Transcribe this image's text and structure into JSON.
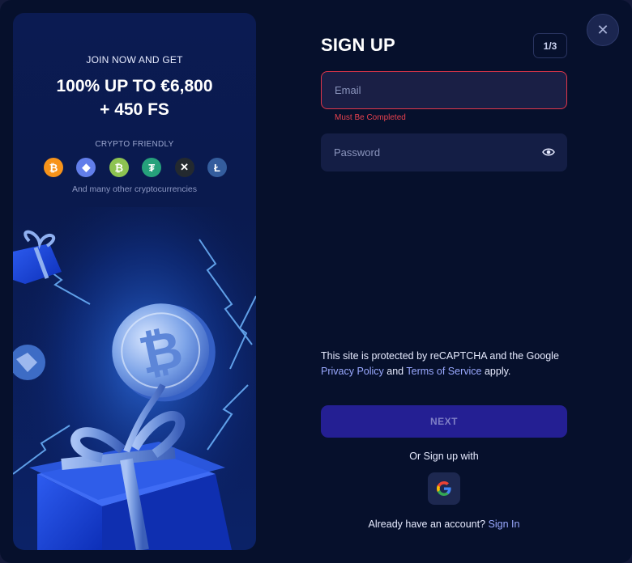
{
  "promo": {
    "kicker": "JOIN NOW AND GET",
    "title_line1": "100% UP TO €6,800",
    "title_line2": "+ 450 FS",
    "crypto_label": "CRYPTO FRIENDLY",
    "coins": [
      {
        "name": "bitcoin",
        "glyph": "₿",
        "color": "#f7931a"
      },
      {
        "name": "ethereum",
        "glyph": "◆",
        "color": "#627eea"
      },
      {
        "name": "bitcoin-cash",
        "glyph": "₿",
        "color": "#8dc351"
      },
      {
        "name": "tether",
        "glyph": "₮",
        "color": "#26a17b"
      },
      {
        "name": "xrp",
        "glyph": "✕",
        "color": "#23292f"
      },
      {
        "name": "litecoin",
        "glyph": "Ł",
        "color": "#345d9d"
      }
    ],
    "note": "And many other cryptocurrencies"
  },
  "form": {
    "title": "SIGN UP",
    "step": "1/3",
    "email_placeholder": "Email",
    "email_error": "Must Be Completed",
    "password_placeholder": "Password",
    "recaptcha_pre": "This site is protected by reCAPTCHA and the Google",
    "privacy_link": "Privacy Policy",
    "recaptcha_and": "and",
    "terms_link": "Terms of Service",
    "recaptcha_post": "apply.",
    "next_label": "NEXT",
    "alt_label": "Or Sign up with",
    "account_prompt": "Already have an account?",
    "signin_link": "Sign In"
  },
  "colors": {
    "background": "#06102c",
    "accent": "#241f93",
    "error": "#e2364a",
    "link": "#9aa9ff"
  }
}
